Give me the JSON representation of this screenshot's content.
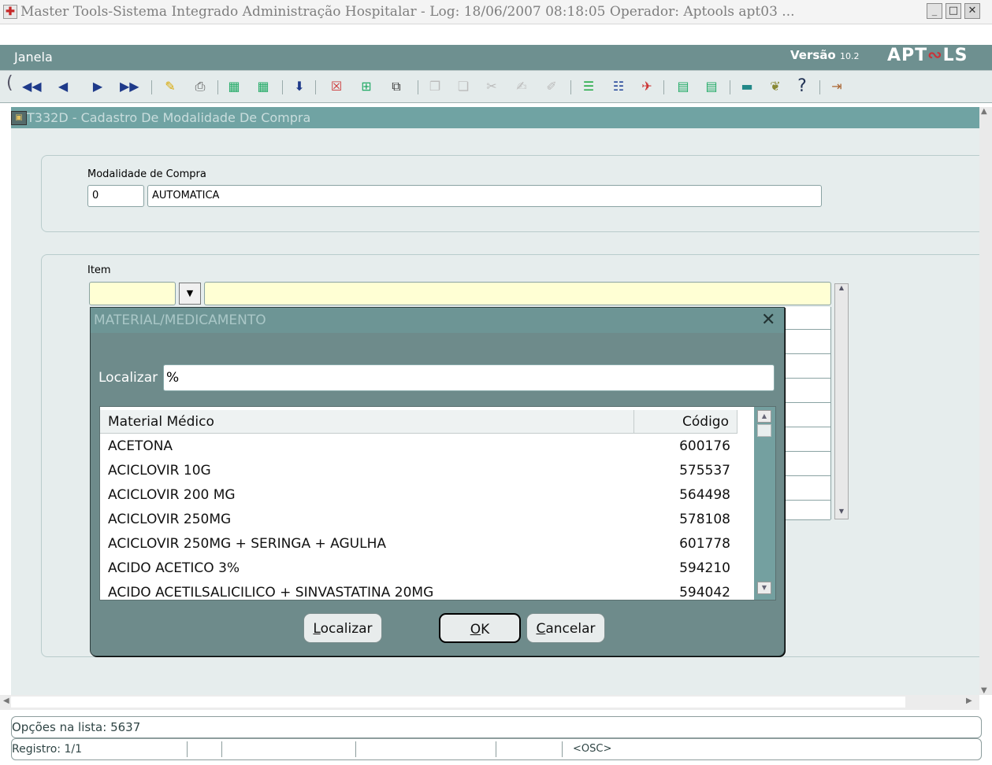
{
  "window": {
    "title": "Master Tools-Sistema Integrado Administração Hospitalar - Log: 18/06/2007 08:18:05 Operador: Aptools apt03 ...",
    "minimize": "_",
    "maximize": "□",
    "close": "✕"
  },
  "menubar": {
    "janela_rest": "anela",
    "janela_first": "J",
    "version_label": "Versão",
    "version_number": "10.2",
    "logo_a": "APT",
    "logo_b": "∾",
    "logo_c": "LS"
  },
  "toolbar": {
    "icons": [
      "first-record-icon",
      "previous-record-icon",
      "next-record-icon",
      "last-record-icon",
      "edit-icon",
      "print-icon",
      "query-icon",
      "clear-query-icon",
      "save-icon",
      "delete-record-icon",
      "insert-record-icon",
      "duplicate-icon",
      "copy-icon",
      "paste-icon",
      "cut-icon",
      "edit-field-icon",
      "clear-field-icon",
      "list-icon",
      "menu-icon",
      "tools-icon",
      "calc-icon",
      "calc2-icon",
      "screen-icon",
      "help-wizard-icon",
      "help-icon",
      "exit-icon"
    ]
  },
  "form": {
    "title": "T332D - Cadastro De  Modalidade De Compra",
    "modalidade_label": "Modalidade de Compra",
    "modalidade_code": "0",
    "modalidade_name": "AUTOMATICA",
    "item_label": "Item"
  },
  "dialog": {
    "title": "MATERIAL/MEDICAMENTO",
    "find_label": "Localizar",
    "find_value": "%",
    "col_name": "Material Médico",
    "col_code": "Código",
    "rows": [
      {
        "name": "ACETONA",
        "code": "600176"
      },
      {
        "name": "ACICLOVIR 10G",
        "code": "575537"
      },
      {
        "name": "ACICLOVIR 200 MG",
        "code": "564498"
      },
      {
        "name": "ACICLOVIR 250MG",
        "code": "578108"
      },
      {
        "name": "ACICLOVIR 250MG + SERINGA + AGULHA",
        "code": "601778"
      },
      {
        "name": "ACIDO ACETICO 3%",
        "code": "594210"
      },
      {
        "name": "ACIDO ACETILSALICILICO + SINVASTATINA 20MG",
        "code": "594042"
      }
    ],
    "btn_find_first": "L",
    "btn_find_rest": "ocalizar",
    "btn_ok_first": "O",
    "btn_ok_rest": "K",
    "btn_cancel_first": "C",
    "btn_cancel_rest": "ancelar"
  },
  "status": {
    "options": "Opções na lista: 5637",
    "record": "Registro: 1/1",
    "mode": "<OSC>"
  }
}
